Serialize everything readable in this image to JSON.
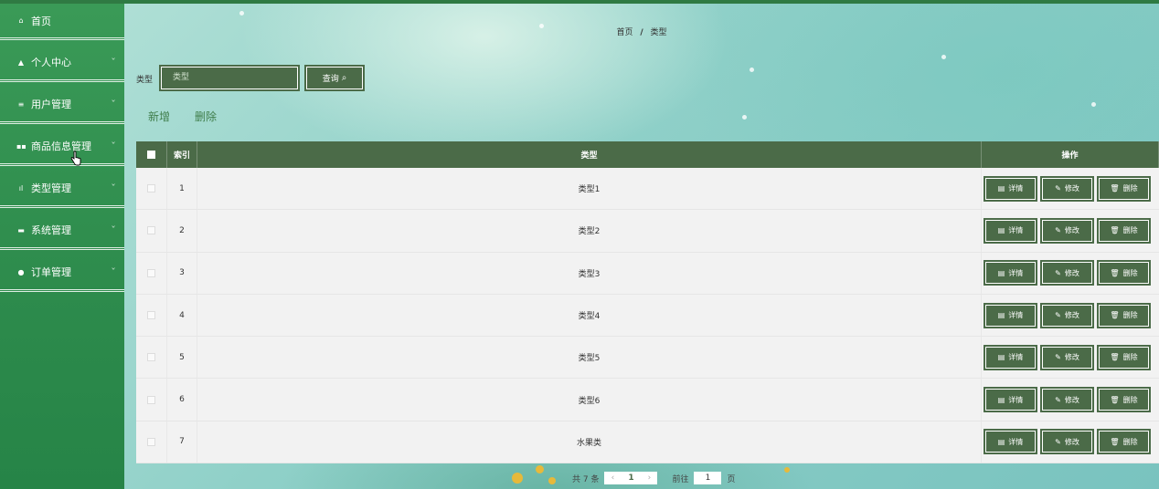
{
  "sidebar": {
    "items": [
      {
        "label": "首页",
        "icon": "home-icon",
        "glyph": "⌂",
        "chevron": false
      },
      {
        "label": "个人中心",
        "icon": "user-icon",
        "glyph": "▲",
        "chevron": true
      },
      {
        "label": "用户管理",
        "icon": "menu-lines-icon",
        "glyph": "≡",
        "chevron": true
      },
      {
        "label": "商品信息管理",
        "icon": "grid-icon",
        "glyph": "▪▪",
        "chevron": true
      },
      {
        "label": "类型管理",
        "icon": "bar-chart-icon",
        "glyph": "ıl",
        "chevron": true
      },
      {
        "label": "系统管理",
        "icon": "monitor-icon",
        "glyph": "▬",
        "chevron": true
      },
      {
        "label": "订单管理",
        "icon": "pin-icon",
        "glyph": "●",
        "chevron": true
      }
    ]
  },
  "breadcrumb": {
    "home": "首页",
    "separator": "/",
    "current": "类型"
  },
  "search": {
    "label": "类型",
    "placeholder": "类型",
    "button_label": "查询",
    "button_icon": "search-icon"
  },
  "actions": {
    "add_label": "新增",
    "delete_label": "删除"
  },
  "table": {
    "columns": {
      "index": "索引",
      "type": "类型",
      "ops": "操作"
    },
    "rows": [
      {
        "index": "1",
        "type": "类型1"
      },
      {
        "index": "2",
        "type": "类型2"
      },
      {
        "index": "3",
        "type": "类型3"
      },
      {
        "index": "4",
        "type": "类型4"
      },
      {
        "index": "5",
        "type": "类型5"
      },
      {
        "index": "6",
        "type": "类型6"
      },
      {
        "index": "7",
        "type": "水果类"
      }
    ],
    "row_buttons": {
      "detail": "详情",
      "edit": "修改",
      "delete": "删除"
    }
  },
  "pagination": {
    "total_text": "共 7 条",
    "current_page": "1",
    "goto_label": "前往",
    "goto_value": "1",
    "page_suffix": "页"
  },
  "colors": {
    "accent": "#4b6b48",
    "sidebar": "#2d8b4c"
  }
}
